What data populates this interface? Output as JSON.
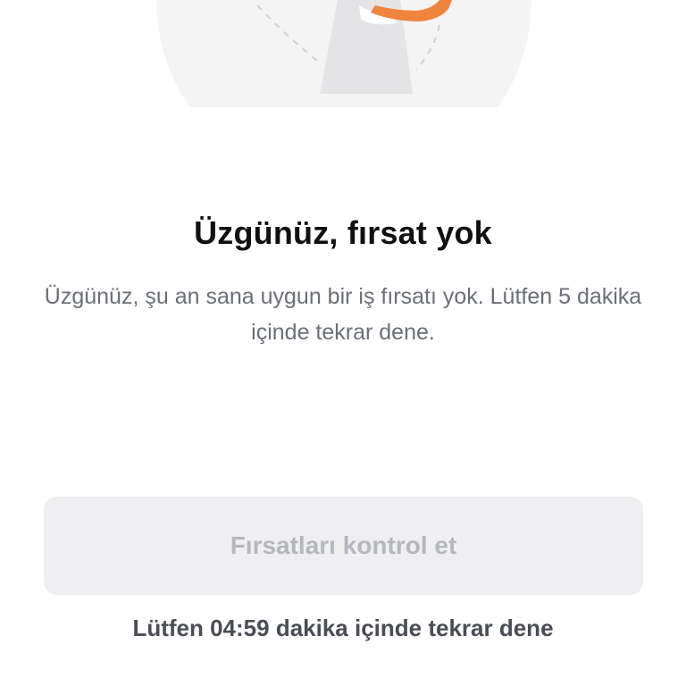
{
  "illustration": {
    "icon": "sad-person-illustration-icon",
    "circle_color": "#f4f4f5",
    "accent_color": "#f0843c"
  },
  "empty_state": {
    "title": "Üzgünüz, fırsat yok",
    "description": "Üzgünüz, şu an sana uygun bir iş fırsatı yok. Lütfen 5 dakika içinde tekrar dene."
  },
  "actions": {
    "check_label": "Fırsatları kontrol et",
    "check_enabled": false
  },
  "countdown": {
    "text": "Lütfen 04:59 dakika içinde tekrar dene"
  },
  "colors": {
    "title": "#111111",
    "body_text": "#6b6f76",
    "button_bg_disabled": "#efeff1",
    "button_text_disabled": "#b4b7bd"
  }
}
